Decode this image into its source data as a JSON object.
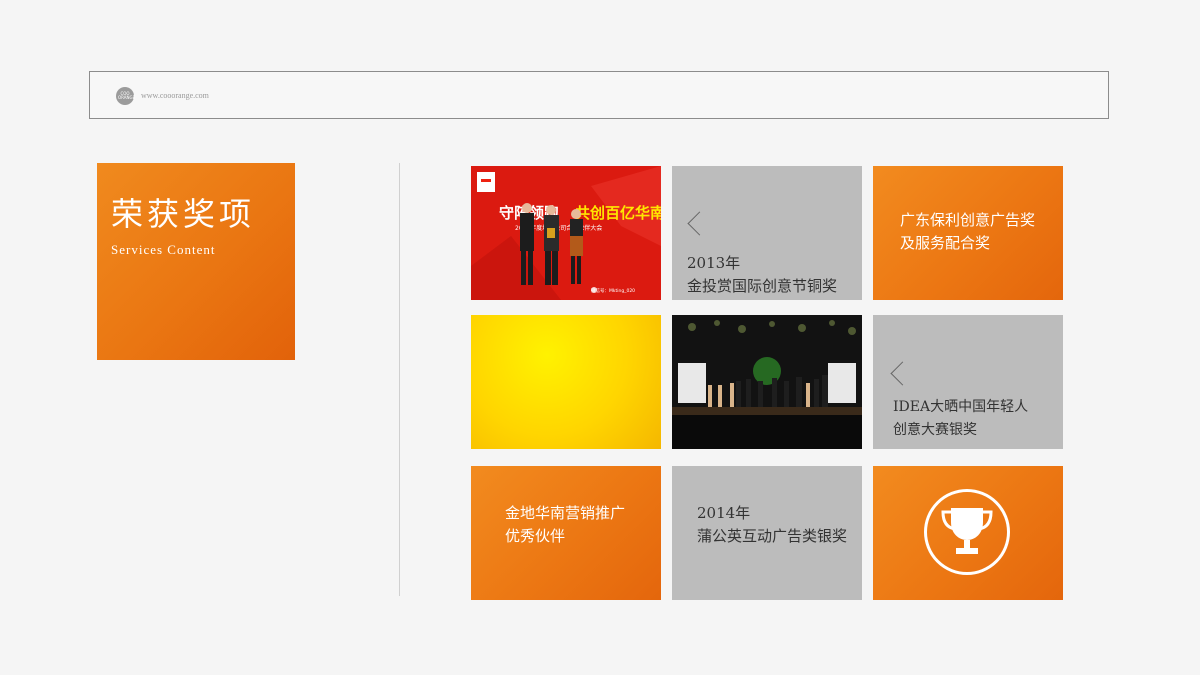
{
  "browser": {
    "url": "www.cooorange.com",
    "logo_text": "COO ORANGE"
  },
  "header": {
    "title_cn": "荣获奖项",
    "title_en": "Services Content"
  },
  "photo1": {
    "banner_left": "守阵领跑",
    "banner_right": "共创百亿华南",
    "banner_sub": "2013年度地产公司合作伙伴大会",
    "watermark": "微信号：Mkting_020"
  },
  "tiles": {
    "t2": {
      "line1": "2013年",
      "line2": "金投赏国际创意节铜奖"
    },
    "t3": {
      "line1": "广东保利创意广告奖",
      "line2": "及服务配合奖"
    },
    "t6": {
      "line1": "IDEA大晒中国年轻人",
      "line2": "创意大赛银奖"
    },
    "t7": {
      "line1": "金地华南营销推广",
      "line2": "优秀伙伴"
    },
    "t8": {
      "line1": "2014年",
      "line2": "蒲公英互动广告类银奖"
    }
  },
  "colors": {
    "accent_orange": "#ec7713",
    "tile_gray": "#bcbcbc",
    "tile_yellow": "#ffd500"
  },
  "icons": {
    "prev": "chevron-left-icon",
    "trophy": "trophy-icon"
  }
}
